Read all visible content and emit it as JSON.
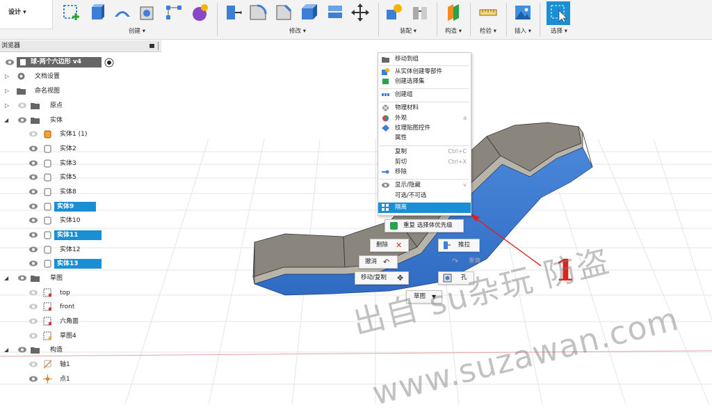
{
  "ribbon": {
    "design_label": "设计 ▾",
    "groups": {
      "create": "创建 ▾",
      "modify": "修改 ▾",
      "assemble": "装配 ▾",
      "construct": "构造 ▾",
      "inspect": "检验 ▾",
      "insert": "插入 ▾",
      "select": "选择 ▾"
    }
  },
  "browser": {
    "title": "浏览器",
    "root": "球-两个六边形 v4",
    "doc_settings": "文档设置",
    "named_views": "命名视图",
    "origin": "原点",
    "bodies_folder": "实体",
    "bodies": [
      "实体1 (1)",
      "实体2",
      "实体3",
      "实体5",
      "实体8",
      "实体9",
      "实体10",
      "实体11",
      "实体12",
      "实体13"
    ],
    "sketches_folder": "草图",
    "sketches": [
      "top",
      "front",
      "六角面",
      "草图4"
    ],
    "construction_folder": "构造",
    "construction": [
      "轴1",
      "点1"
    ]
  },
  "context_menu": {
    "items": [
      {
        "label": "移动到组",
        "shortcut": ""
      },
      {
        "label": "从实体创建零部件",
        "shortcut": ""
      },
      {
        "label": "创建选择集",
        "shortcut": ""
      },
      {
        "label": "创建组",
        "shortcut": ""
      },
      {
        "label": "物理材料",
        "shortcut": ""
      },
      {
        "label": "外观",
        "shortcut": "a"
      },
      {
        "label": "纹理贴图控件",
        "shortcut": ""
      },
      {
        "label": "属性",
        "shortcut": ""
      },
      {
        "label": "复制",
        "shortcut": "Ctrl+C"
      },
      {
        "label": "剪切",
        "shortcut": "Ctrl+X"
      },
      {
        "label": "移除",
        "shortcut": ""
      },
      {
        "label": "显示/隐藏",
        "shortcut": "v"
      },
      {
        "label": "可选/不可选",
        "shortcut": ""
      },
      {
        "label": "隔离",
        "shortcut": ""
      }
    ]
  },
  "marking_menu": {
    "repeat": "重复 选择体优先级",
    "delete": "删除",
    "extrude": "推拉",
    "undo": "撤消",
    "redo": "重做",
    "move_copy": "移动/复制",
    "hole": "孔",
    "sketch": "草图"
  },
  "annotation": {
    "marker": "1"
  },
  "watermark": {
    "line1": "出自 su杂玩 防盗",
    "line2": "www.suzawan.com"
  }
}
